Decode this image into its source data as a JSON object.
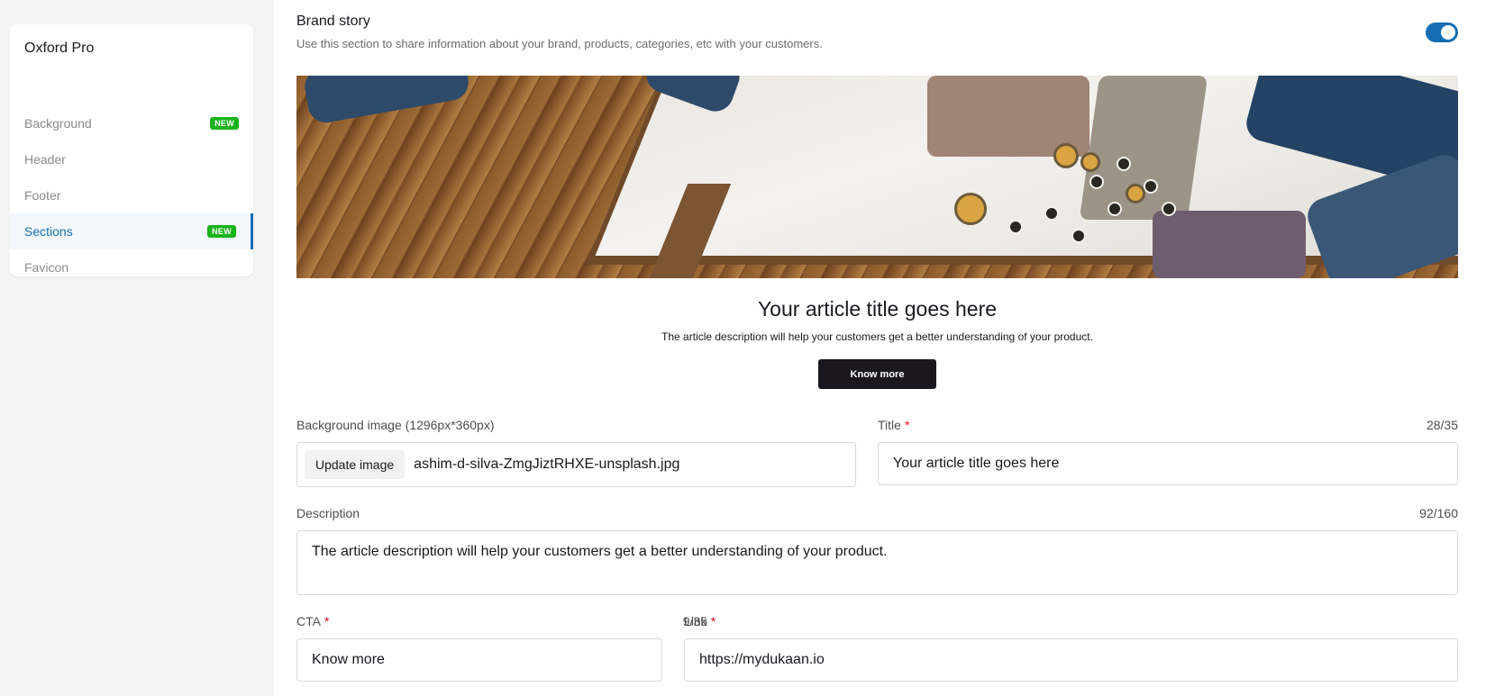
{
  "sidebar": {
    "title": "Oxford Pro",
    "items": [
      {
        "label": "Background",
        "badge": "NEW"
      },
      {
        "label": "Header",
        "badge": ""
      },
      {
        "label": "Footer",
        "badge": ""
      },
      {
        "label": "Sections",
        "badge": "NEW"
      },
      {
        "label": "Favicon",
        "badge": ""
      }
    ],
    "active": "Sections"
  },
  "section": {
    "title": "Brand story",
    "subtitle": "Use this section to share information about your brand, products, categories, etc with your customers.",
    "enabled": true
  },
  "preview": {
    "title": "Your article title goes here",
    "description": "The article description will help your customers get a better understanding of your product.",
    "cta": "Know more"
  },
  "form": {
    "bg_image_label": "Background image (1296px*360px)",
    "update_image_label": "Update image",
    "bg_image_filename": "ashim-d-silva-ZmgJiztRHXE-unsplash.jpg",
    "title_label": "Title",
    "title_counter": "28/35",
    "title_value": "Your article title goes here",
    "description_label": "Description",
    "description_counter": "92/160",
    "description_value": "The article description will help your customers get a better understanding of your product.",
    "cta_label": "CTA",
    "cta_counter": "9/35",
    "cta_value": "Know more",
    "link_label": "Link",
    "link_value": "https://mydukaan.io",
    "required_mark": "*"
  },
  "colors": {
    "accent": "#146eb4",
    "badge": "#17b31b",
    "required": "#e50b20",
    "button_dark": "#1a181e"
  }
}
